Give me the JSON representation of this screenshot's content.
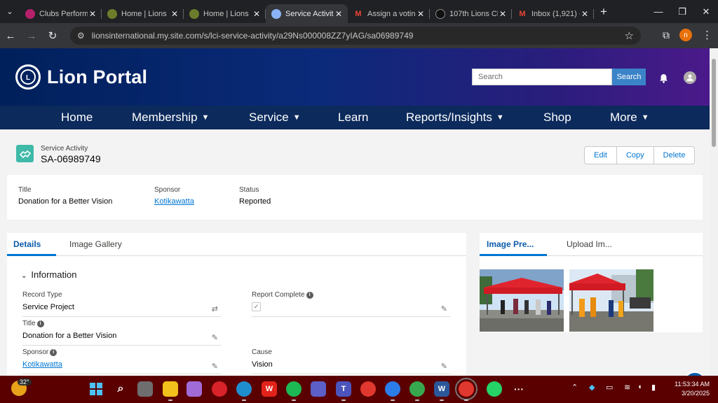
{
  "browser": {
    "tabs": [
      {
        "title": "Clubs Perform",
        "active": false
      },
      {
        "title": "Home | Lions",
        "active": false
      },
      {
        "title": "Home | Lions",
        "active": false
      },
      {
        "title": "Service Activit",
        "active": true
      },
      {
        "title": "Assign a votin",
        "active": false
      },
      {
        "title": "107th Lions Cl",
        "active": false
      },
      {
        "title": "Inbox (1,921) -",
        "active": false
      }
    ],
    "url": "lionsinternational.my.site.com/s/lci-service-activity/a29Ns000008ZZ7yIAG/sa06989749",
    "profile_initial": "n"
  },
  "site": {
    "logo_text": "Lion Portal",
    "search_placeholder": "Search",
    "search_button": "Search"
  },
  "nav": [
    {
      "label": "Home",
      "has_dropdown": false
    },
    {
      "label": "Membership",
      "has_dropdown": true
    },
    {
      "label": "Service",
      "has_dropdown": true
    },
    {
      "label": "Learn",
      "has_dropdown": false
    },
    {
      "label": "Reports/Insights",
      "has_dropdown": true
    },
    {
      "label": "Shop",
      "has_dropdown": false
    },
    {
      "label": "More",
      "has_dropdown": true
    }
  ],
  "record": {
    "type": "Service Activity",
    "id": "SA-06989749",
    "actions": [
      "Edit",
      "Copy",
      "Delete"
    ],
    "highlights": [
      {
        "label": "Title",
        "value": "Donation for a Better Vision",
        "link": false
      },
      {
        "label": "Sponsor",
        "value": "Kotikawatta",
        "link": true
      },
      {
        "label": "Status",
        "value": "Reported",
        "link": false
      }
    ]
  },
  "details": {
    "tabs": [
      "Details",
      "Image Gallery"
    ],
    "section": "Information",
    "fields": {
      "record_type": {
        "label": "Record Type",
        "value": "Service Project"
      },
      "report_complete": {
        "label": "Report Complete",
        "checked": true
      },
      "title": {
        "label": "Title",
        "value": "Donation for a Better Vision"
      },
      "sponsor": {
        "label": "Sponsor",
        "value": "Kotikawatta"
      },
      "cause": {
        "label": "Cause",
        "value": "Vision"
      }
    }
  },
  "images_panel": {
    "tabs": [
      "Image Pre...",
      "Upload Im..."
    ]
  },
  "taskbar": {
    "weather_temp": "32°",
    "time": "11:53:34 AM",
    "date": "3/20/2025"
  }
}
